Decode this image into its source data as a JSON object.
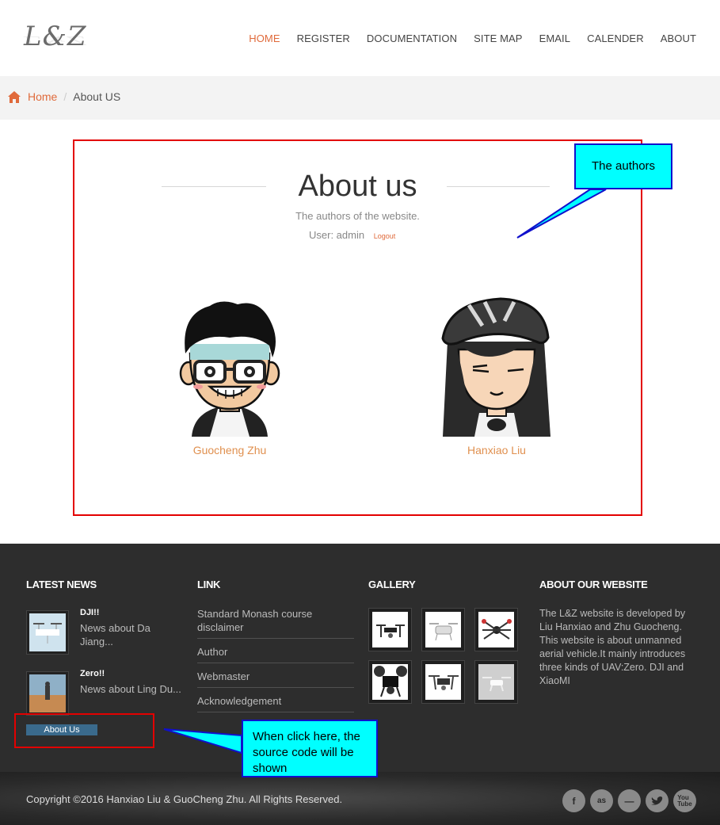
{
  "header": {
    "logo": "L&Z",
    "nav": [
      {
        "label": "HOME",
        "active": true
      },
      {
        "label": "REGISTER"
      },
      {
        "label": "DOCUMENTATION"
      },
      {
        "label": "SITE MAP"
      },
      {
        "label": "EMAIL"
      },
      {
        "label": "CALENDER"
      },
      {
        "label": "ABOUT"
      }
    ]
  },
  "breadcrumb": {
    "home": "Home",
    "separator": "/",
    "current": "About US"
  },
  "about": {
    "title": "About us",
    "subtitle": "The authors of the website.",
    "user_label": "User: admin",
    "logout": "Logout",
    "authors": [
      {
        "name": "Guocheng Zhu"
      },
      {
        "name": "Hanxiao Liu"
      }
    ]
  },
  "callouts": {
    "authors": "The authors",
    "source": [
      "When click here, the",
      "source code will be",
      "shown"
    ]
  },
  "footer": {
    "latest_news": {
      "title": "LATEST NEWS",
      "items": [
        {
          "title": "DJI!!",
          "desc": "News about Da Jiang..."
        },
        {
          "title": "Zero!!",
          "desc": "News about Ling Du..."
        }
      ],
      "about_button": "About Us"
    },
    "link": {
      "title": "LINK",
      "items": [
        "Standard Monash course disclaimer",
        "Author",
        "Webmaster",
        "Acknowledgement"
      ]
    },
    "gallery": {
      "title": "GALLERY"
    },
    "about_site": {
      "title": "ABOUT OUR WEBSITE",
      "text": "The L&Z website is developed by Liu Hanxiao and Zhu Guocheng. This website is about unmanned aerial vehicle.It mainly introduces three kinds of UAV:Zero. DJI and XiaoMI"
    }
  },
  "bottom": {
    "copyright": "Copyright ©2016 Hanxiao Liu & GuoCheng Zhu. All Rights Reserved.",
    "social": [
      "facebook-icon",
      "lastfm-icon",
      "more-icon",
      "twitter-icon",
      "youtube-icon"
    ]
  },
  "colors": {
    "accent": "#e06a3b",
    "callout_fill": "#00ffff",
    "callout_border": "#1010cc",
    "highlight_border": "#e30000",
    "footer_bg": "#2d2d2d"
  }
}
